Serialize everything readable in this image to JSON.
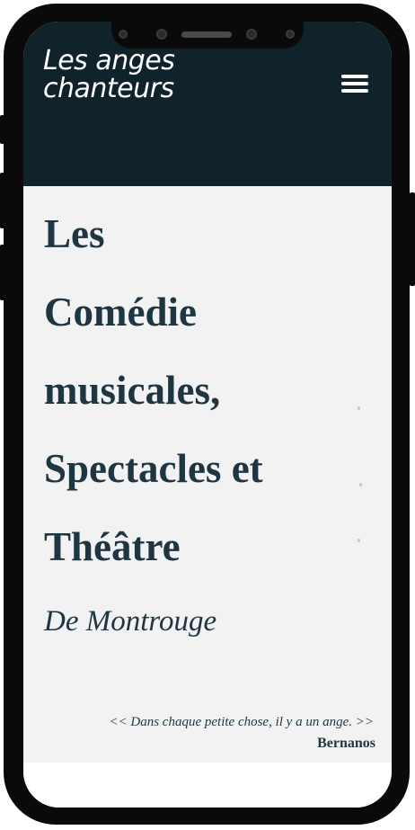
{
  "header": {
    "logo_line1": "Les anges",
    "logo_line2": "chanteurs",
    "menu_icon": "hamburger-menu-icon"
  },
  "hero": {
    "title_lines": [
      "Les",
      "Comédie",
      "musicales,",
      "Spectacles et",
      "Théâtre"
    ],
    "subtitle": "De Montrouge",
    "quote": "<< Dans chaque petite chose, il y a un ange. >>",
    "author": "Bernanos"
  },
  "colors": {
    "header_bg": "#10232a",
    "hero_bg": "#f1f2f1",
    "text_dark": "#1e3642",
    "phone_frame": "#0a0a0a"
  }
}
